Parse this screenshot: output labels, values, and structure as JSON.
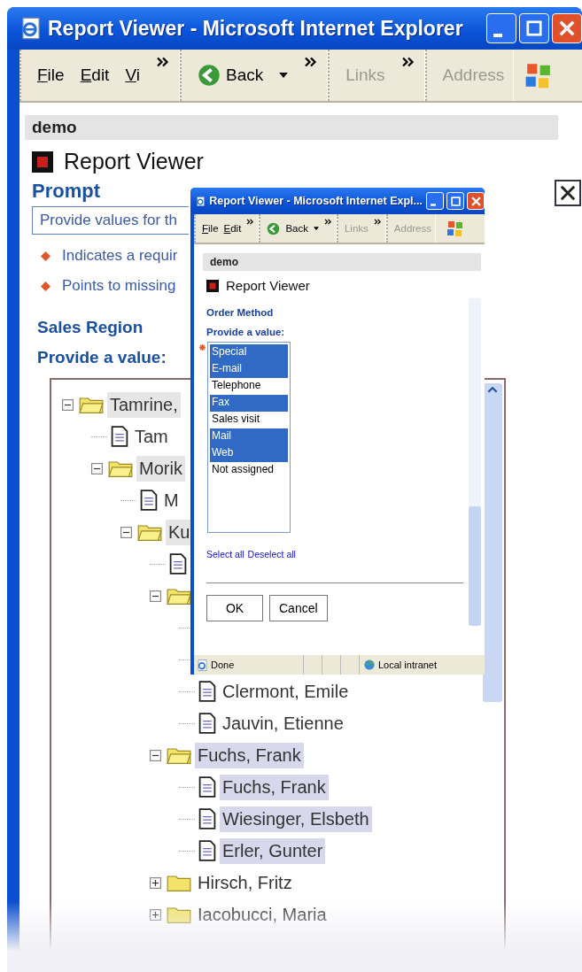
{
  "main_window": {
    "title": "Report Viewer - Microsoft Internet Explorer",
    "menu": [
      "File",
      "Edit",
      "Vi"
    ],
    "back_button": "Back",
    "links": "Links",
    "address": "Address",
    "page": {
      "site": "demo",
      "header": "Report Viewer",
      "prompt_title": "Prompt",
      "intro": "Provide values for th",
      "notes": [
        "Indicates a requir",
        "Points to missing"
      ],
      "section": "Sales Region",
      "instruction": "Provide a value:",
      "tree": [
        {
          "kind": "folder",
          "label": "Tamrine,",
          "expanded": true,
          "selected": false,
          "partial": true,
          "children": [
            {
              "kind": "doc",
              "label": "Tam",
              "selected": false,
              "partial": false
            },
            {
              "kind": "folder",
              "label": "Morik",
              "expanded": true,
              "selected": false,
              "partial": true,
              "children": [
                {
                  "kind": "doc",
                  "label": "M",
                  "selected": false,
                  "partial": false
                },
                {
                  "kind": "folder",
                  "label": "Ku",
                  "expanded": true,
                  "selected": false,
                  "partial": true,
                  "children": [
                    {
                      "kind": "doc"
                    },
                    {
                      "kind": "folder",
                      "expanded": true,
                      "children": [
                        {
                          "kind": "doc"
                        },
                        {
                          "kind": "doc"
                        },
                        {
                          "kind": "doc",
                          "label": "Clermont, Emile",
                          "selected": false,
                          "partial": false
                        },
                        {
                          "kind": "doc",
                          "label": "Jauvin, Etienne",
                          "selected": false,
                          "partial": false
                        }
                      ]
                    },
                    {
                      "kind": "folder",
                      "label": "Fuchs, Frank",
                      "expanded": true,
                      "selected": true,
                      "children": [
                        {
                          "kind": "doc",
                          "label": "Fuchs, Frank",
                          "selected": true
                        },
                        {
                          "kind": "doc",
                          "label": "Wiesinger, Elsbeth",
                          "selected": true
                        },
                        {
                          "kind": "doc",
                          "label": "Erler, Gunter",
                          "selected": true
                        }
                      ]
                    },
                    {
                      "kind": "folder",
                      "label": "Hirsch, Fritz",
                      "expanded": false,
                      "selected": false,
                      "partial": false
                    },
                    {
                      "kind": "folder",
                      "label": "Iacobucci, Maria",
                      "expanded": false,
                      "selected": false,
                      "partial": false
                    }
                  ]
                }
              ]
            }
          ]
        }
      ]
    }
  },
  "popup_window": {
    "title": "Report Viewer - Microsoft Internet Expl...",
    "menu": [
      "File",
      "Edit"
    ],
    "back_button": "Back",
    "links": "Links",
    "address": "Address",
    "page": {
      "site": "demo",
      "header": "Report Viewer",
      "label": "Order Method",
      "instruction": "Provide a value:",
      "required": true,
      "options": [
        {
          "label": "Special",
          "selected": true
        },
        {
          "label": "E-mail",
          "selected": true
        },
        {
          "label": "Telephone",
          "selected": false
        },
        {
          "label": "Fax",
          "selected": true
        },
        {
          "label": "Sales visit",
          "selected": false
        },
        {
          "label": "Mail",
          "selected": true
        },
        {
          "label": "Web",
          "selected": true
        },
        {
          "label": "Not assigned",
          "selected": false
        }
      ],
      "links": [
        "Select all",
        "Deselect all"
      ],
      "buttons": [
        "OK",
        "Cancel"
      ]
    },
    "status_bar": {
      "text": "Done",
      "zone": "Local intranet"
    }
  }
}
